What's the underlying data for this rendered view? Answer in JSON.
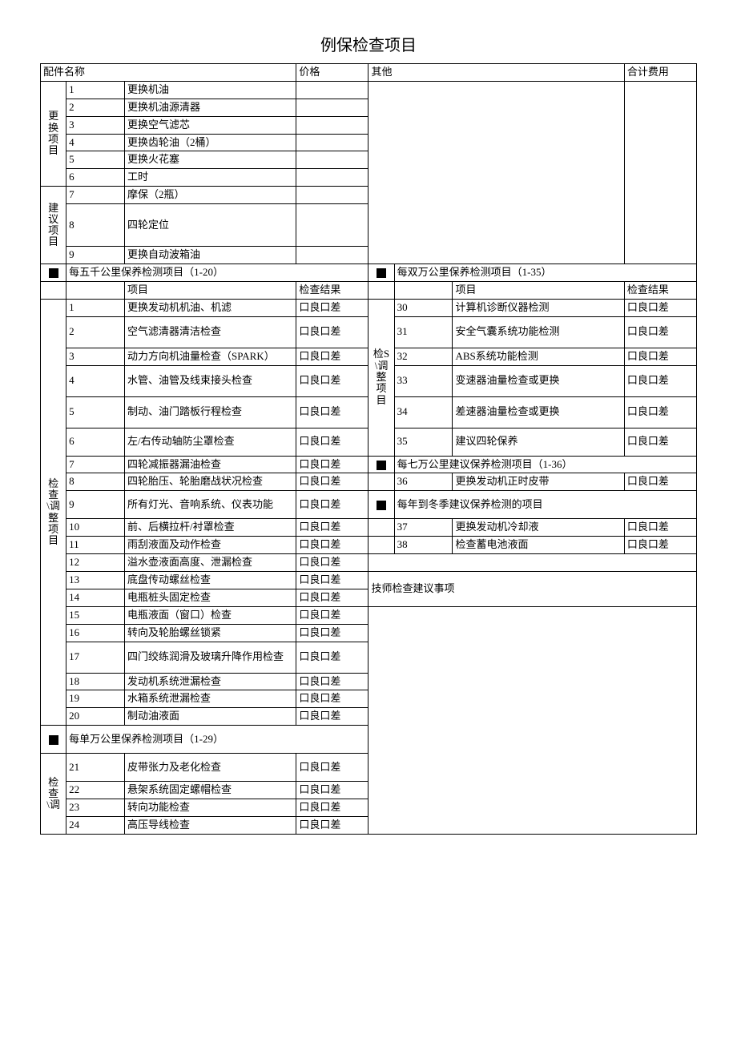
{
  "title": "例保检查项目",
  "header": {
    "parts_name": "配件名称",
    "price": "价格",
    "other": "其他",
    "total_fee": "合计费用"
  },
  "replace_label": "更换项目",
  "suggest_label": "建议项目",
  "replace_items": [
    {
      "n": "1",
      "t": "更换机油"
    },
    {
      "n": "2",
      "t": "更换机油源清器"
    },
    {
      "n": "3",
      "t": "更换空气滤芯"
    },
    {
      "n": "4",
      "t": "更换齿轮油（2桶）"
    },
    {
      "n": "5",
      "t": "更换火花塞"
    },
    {
      "n": "6",
      "t": "工时"
    }
  ],
  "suggest_items": [
    {
      "n": "7",
      "t": "摩保（2瓶）"
    },
    {
      "n": "8",
      "t": "四轮定位"
    },
    {
      "n": "9",
      "t": "更换自动波箱油"
    }
  ],
  "sec_5k": "每五千公里保养检测项目（1-20）",
  "sec_20k": "每双万公里保养检测项目（1-35）",
  "sec_10k": "每单万公里保养检测项目（1-29）",
  "sec_70k": "每七万公里建议保养检测项目（1-36）",
  "sec_winter": "每年到冬季建议保养检测的项目",
  "tech_advice": "技师检查建议事项",
  "col_item": "项目",
  "col_result": "检查结果",
  "result_txt": "口良口差",
  "left_group_label": "检查\\调整项目",
  "right_group_label": "检S\\调整项目",
  "left_group2_label": "检查\\调",
  "left_items": [
    {
      "n": "1",
      "t": "更换发动机机油、机滤"
    },
    {
      "n": "2",
      "t": "空气滤清器清洁检查"
    },
    {
      "n": "3",
      "t": "动力方向机油量检查（SPARK）"
    },
    {
      "n": "4",
      "t": "水管、油管及线束接头检查"
    },
    {
      "n": "5",
      "t": "制动、油门踏板行程检查"
    },
    {
      "n": "6",
      "t": "左/右传动轴防尘罩检查"
    },
    {
      "n": "7",
      "t": "四轮减振器漏油检查"
    },
    {
      "n": "8",
      "t": "四轮胎压、轮胎磨战状况检查"
    },
    {
      "n": "9",
      "t": "所有灯光、音响系统、仪表功能"
    },
    {
      "n": "10",
      "t": "前、后横拉杆/衬罩检查"
    },
    {
      "n": "11",
      "t": "雨刮液面及动作检查"
    },
    {
      "n": "12",
      "t": "溢水壶液面高度、泄漏检查"
    },
    {
      "n": "13",
      "t": "底盘传动螺丝检查"
    },
    {
      "n": "14",
      "t": "电瓶桩头固定检查"
    },
    {
      "n": "15",
      "t": "电瓶液面（窗口）检查"
    },
    {
      "n": "16",
      "t": "转向及轮胎螺丝锁紧"
    },
    {
      "n": "17",
      "t": "四门绞练润滑及玻璃升降作用检查"
    },
    {
      "n": "18",
      "t": "发动机系统泄漏检查"
    },
    {
      "n": "19",
      "t": "水箱系统泄漏检查"
    },
    {
      "n": "20",
      "t": "制动油液面"
    }
  ],
  "left_items2": [
    {
      "n": "21",
      "t": "皮带张力及老化检查"
    },
    {
      "n": "22",
      "t": "悬架系统固定螺帽检查"
    },
    {
      "n": "23",
      "t": "转向功能检查"
    },
    {
      "n": "24",
      "t": "高压导线检查"
    }
  ],
  "right_items": [
    {
      "n": "30",
      "t": "计算机诊断仪器检测"
    },
    {
      "n": "31",
      "t": "安全气囊系统功能检测"
    },
    {
      "n": "32",
      "t": "ABS系统功能检测"
    },
    {
      "n": "33",
      "t": "变速器油量检查或更换"
    },
    {
      "n": "34",
      "t": "差速器油量检查或更换"
    },
    {
      "n": "35",
      "t": "建议四轮保养"
    }
  ],
  "right_70k": [
    {
      "n": "36",
      "t": "更换发动机正时皮带"
    }
  ],
  "right_winter": [
    {
      "n": "37",
      "t": "更换发动机冷却液"
    },
    {
      "n": "38",
      "t": "检查蓄电池液面"
    }
  ]
}
